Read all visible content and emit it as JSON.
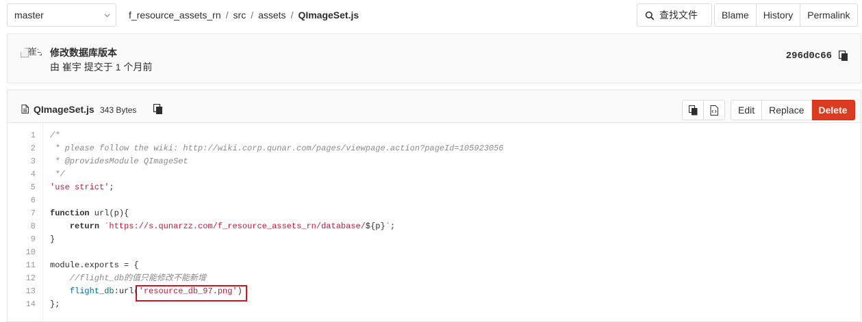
{
  "branch": {
    "name": "master"
  },
  "breadcrumb": [
    {
      "label": "f_resource_assets_rn"
    },
    {
      "label": "src"
    },
    {
      "label": "assets"
    },
    {
      "label": "QImageSet.js"
    }
  ],
  "breadcrumb_sep": "/",
  "toolbar": {
    "find_file": "查找文件",
    "blame": "Blame",
    "history": "History",
    "permalink": "Permalink"
  },
  "commit": {
    "avatar_alt": "崔宇's",
    "title": "修改数据库版本",
    "meta": "由 崔宇 提交于 1 个月前",
    "sha": "296d0c66"
  },
  "file": {
    "name": "QImageSet.js",
    "size": "343 Bytes",
    "edit": "Edit",
    "replace": "Replace",
    "delete": "Delete"
  },
  "code": {
    "line_numbers": [
      "1",
      "2",
      "3",
      "4",
      "5",
      "6",
      "7",
      "8",
      "9",
      "10",
      "11",
      "12",
      "13",
      "14"
    ],
    "lines": [
      [
        {
          "t": "/*",
          "c": "cm"
        }
      ],
      [
        {
          "t": " * please follow the wiki: http://wiki.corp.qunar.com/pages/viewpage.action?pageId=105923056",
          "c": "cm"
        }
      ],
      [
        {
          "t": " * @providesModule QImageSet",
          "c": "cm"
        }
      ],
      [
        {
          "t": " */",
          "c": "cm"
        }
      ],
      [
        {
          "t": "'use strict'",
          "c": "str"
        },
        {
          "t": ";",
          "c": ""
        }
      ],
      [
        {
          "t": "",
          "c": ""
        }
      ],
      [
        {
          "t": "function",
          "c": "kw"
        },
        {
          "t": " url(p){",
          "c": ""
        }
      ],
      [
        {
          "t": "    ",
          "c": ""
        },
        {
          "t": "return",
          "c": "kw"
        },
        {
          "t": " ",
          "c": ""
        },
        {
          "t": "`https://s.qunarzz.com/f_resource_assets_rn/database/",
          "c": "str"
        },
        {
          "t": "${p}",
          "c": ""
        },
        {
          "t": "`",
          "c": "str"
        },
        {
          "t": ";",
          "c": ""
        }
      ],
      [
        {
          "t": "}",
          "c": ""
        }
      ],
      [
        {
          "t": "",
          "c": ""
        }
      ],
      [
        {
          "t": "module.exports = {",
          "c": ""
        }
      ],
      [
        {
          "t": "    //flight_db的值只能修改不能新增",
          "c": "cm"
        }
      ],
      [
        {
          "t": "    ",
          "c": ""
        },
        {
          "t": "flight_db",
          "c": "prop"
        },
        {
          "t": ":url(",
          "c": ""
        },
        {
          "t": "'resource_db_97.png'",
          "c": "str"
        },
        {
          "t": ")",
          "c": ""
        }
      ],
      [
        {
          "t": "};",
          "c": ""
        }
      ]
    ]
  },
  "colors": {
    "delete_button": "#db3b21",
    "highlight_box": "#d90f1a",
    "string": "#c41a3a",
    "comment": "#8a8a8a"
  }
}
